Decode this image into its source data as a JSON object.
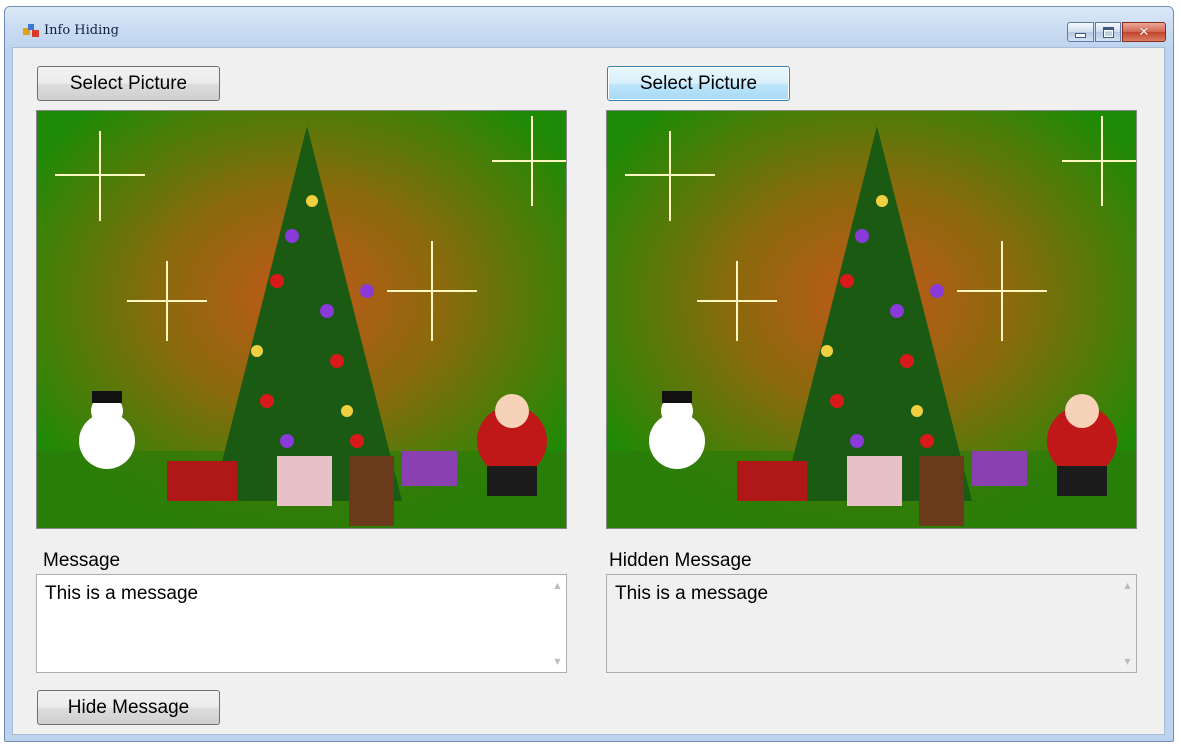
{
  "window": {
    "title": "Info Hiding"
  },
  "left_panel": {
    "select_label": "Select Picture",
    "message_label": "Message",
    "message_text": "This is a message",
    "hide_label": "Hide Message"
  },
  "right_panel": {
    "select_label": "Select Picture",
    "hidden_label": "Hidden Message",
    "hidden_text": "This is a message"
  },
  "colors": {
    "background_green": "#1f8a06",
    "background_orange": "#c2581a",
    "tree_green": "#1a5a12"
  }
}
